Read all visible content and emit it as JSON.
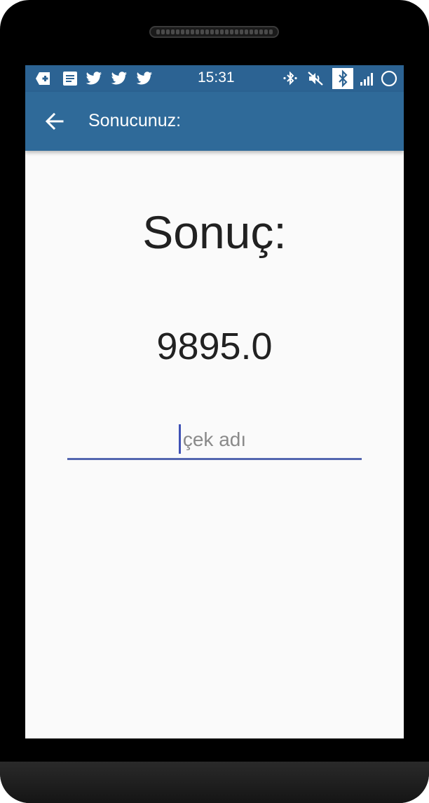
{
  "status_bar": {
    "time": "15:31",
    "left_icons": [
      "plus-box-icon",
      "document-icon",
      "twitter-icon",
      "twitter-icon",
      "twitter-icon"
    ],
    "right_icons": [
      "bluetooth-signal-icon",
      "muted-speaker-icon",
      "bluetooth-icon",
      "cell-signal-icon",
      "circle-icon"
    ]
  },
  "app_bar": {
    "title": "Sonucunuz:"
  },
  "main": {
    "result_label": "Sonuç:",
    "result_value": "9895.0",
    "name_input": {
      "value": "",
      "placeholder": "çek adı"
    }
  },
  "colors": {
    "status_bar": "#2c6393",
    "app_bar": "#2f6a99",
    "background": "#fafafa",
    "input_underline": "#5466b0"
  }
}
